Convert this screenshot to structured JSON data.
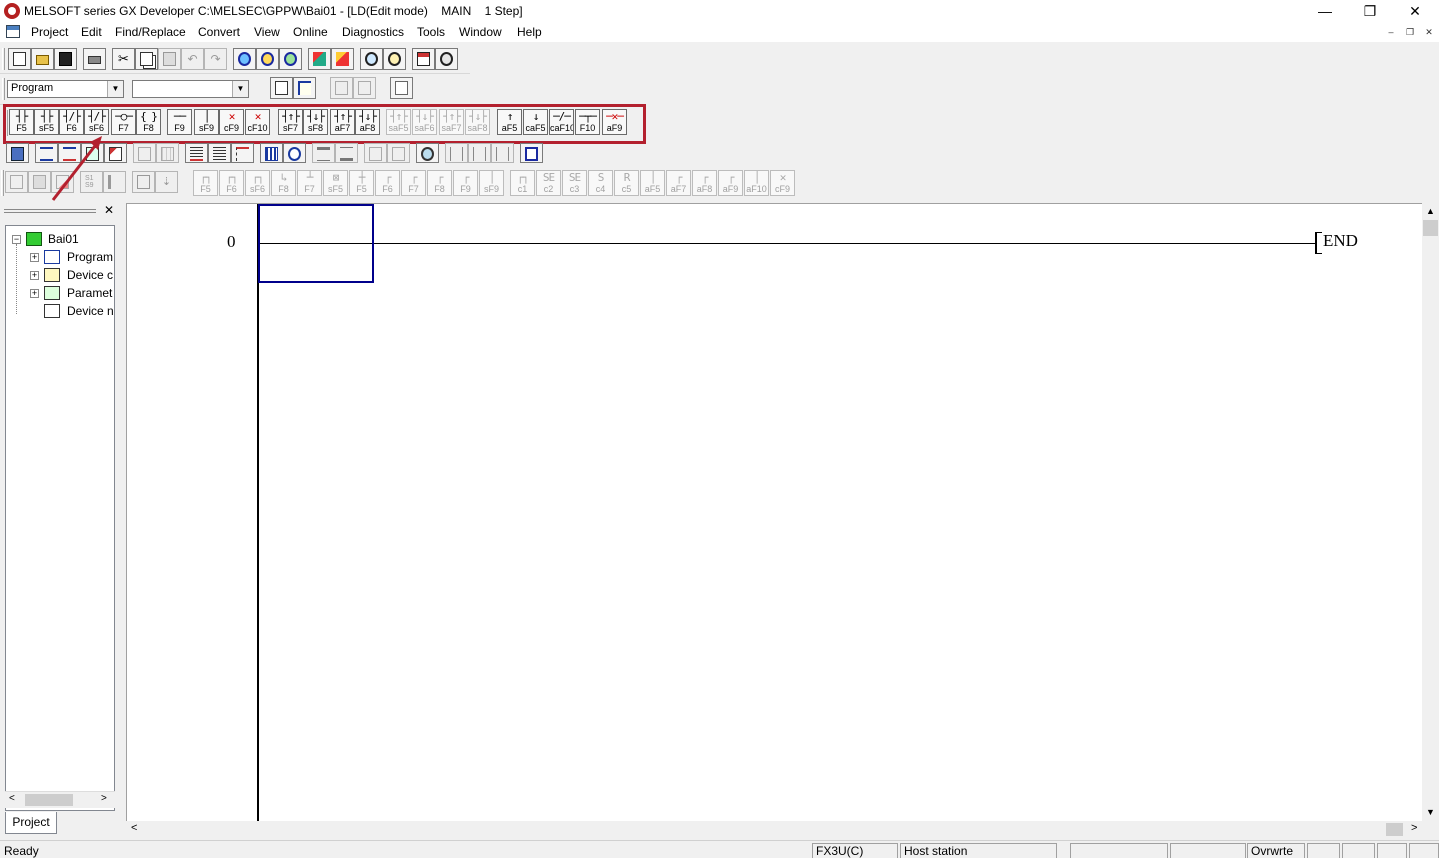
{
  "window": {
    "title": "MELSOFT series GX Developer C:\\MELSEC\\GPPW\\Bai01 - [LD(Edit mode)    MAIN    1 Step]",
    "minimize_glyph": "—",
    "maximize_glyph": "❐",
    "close_glyph": "✕"
  },
  "menu": [
    "Project",
    "Edit",
    "Find/Replace",
    "Convert",
    "View",
    "Online",
    "Diagnostics",
    "Tools",
    "Window",
    "Help"
  ],
  "mdi_controls": [
    "–",
    "❐",
    "✕"
  ],
  "toolbar": {
    "data_type_combo": "Program",
    "data_name_combo": ""
  },
  "ladder_symbols": [
    {
      "sym": "┤├",
      "key": "F5"
    },
    {
      "sym": "┤├",
      "key": "sF5"
    },
    {
      "sym": "┤/├",
      "key": "F6"
    },
    {
      "sym": "┤/├",
      "key": "sF6"
    },
    {
      "sym": "─○─",
      "key": "F7"
    },
    {
      "sym": "{ }",
      "key": "F8"
    },
    {
      "sym": "──",
      "key": "F9"
    },
    {
      "sym": "│",
      "key": "sF9"
    },
    {
      "sym": "✕",
      "key": "cF9"
    },
    {
      "sym": "✕",
      "key": "cF10"
    },
    {
      "sym": "┤↑├",
      "key": "sF7"
    },
    {
      "sym": "┤↓├",
      "key": "sF8"
    },
    {
      "sym": "┤↑├",
      "key": "aF7"
    },
    {
      "sym": "┤↓├",
      "key": "aF8"
    },
    {
      "sym": "┤↑├",
      "key": "saF5"
    },
    {
      "sym": "┤↓├",
      "key": "saF6"
    },
    {
      "sym": "┤↑├",
      "key": "saF7"
    },
    {
      "sym": "┤↓├",
      "key": "saF8"
    },
    {
      "sym": "↑",
      "key": "aF5"
    },
    {
      "sym": "↓",
      "key": "caF5"
    },
    {
      "sym": "─/─",
      "key": "caF10"
    },
    {
      "sym": "─┬─",
      "key": "F10"
    },
    {
      "sym": "─✕─",
      "key": "aF9"
    }
  ],
  "sfc_symbols": [
    {
      "sym": "┌┐",
      "key": "F5"
    },
    {
      "sym": "┌┐",
      "key": "F6"
    },
    {
      "sym": "┌┐",
      "key": "sF6"
    },
    {
      "sym": "↳",
      "key": "F8"
    },
    {
      "sym": "┴",
      "key": "F7"
    },
    {
      "sym": "⊠",
      "key": "sF5"
    },
    {
      "sym": "┼",
      "key": "F5"
    },
    {
      "sym": "┌",
      "key": "F6"
    },
    {
      "sym": "┌",
      "key": "F7"
    },
    {
      "sym": "┌",
      "key": "F8"
    },
    {
      "sym": "┌",
      "key": "F9"
    },
    {
      "sym": "│",
      "key": "sF9"
    },
    {
      "sym": "┌┐",
      "key": "c1"
    },
    {
      "sym": "SE",
      "key": "c2"
    },
    {
      "sym": "SE",
      "key": "c3"
    },
    {
      "sym": "S",
      "key": "c4"
    },
    {
      "sym": "R",
      "key": "c5"
    },
    {
      "sym": "│",
      "key": "aF5"
    },
    {
      "sym": "┌",
      "key": "aF7"
    },
    {
      "sym": "┌",
      "key": "aF8"
    },
    {
      "sym": "┌",
      "key": "aF9"
    },
    {
      "sym": "│",
      "key": "aF10"
    },
    {
      "sym": "✕",
      "key": "cF9"
    }
  ],
  "project_tree": {
    "root": "Bai01",
    "items": [
      "Program",
      "Device c",
      "Paramet",
      "Device n"
    ]
  },
  "project_tab": "Project",
  "ladder": {
    "step_number": "0",
    "end_label": "END"
  },
  "status": {
    "ready": "Ready",
    "plc": "FX3U(C)",
    "station": "Host station",
    "mode": "Ovrwrte"
  },
  "colors": {
    "highlight_box": "#b3202e",
    "cursor": "#00008b"
  }
}
